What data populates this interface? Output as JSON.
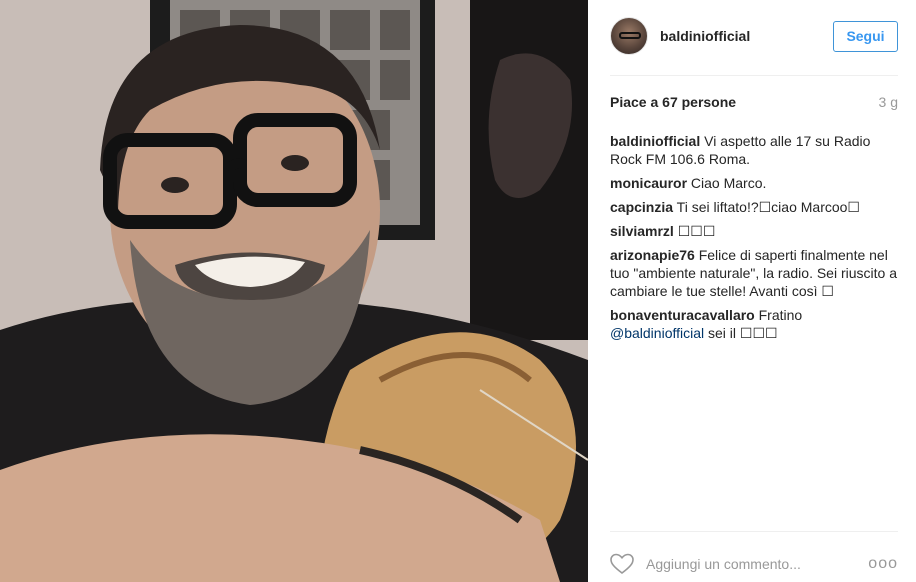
{
  "post": {
    "image_alt": "Selfie of a bearded man with black glasses holding a guitar",
    "username": "baldiniofficial",
    "follow_label": "Segui",
    "likes": "Piace a 67 persone",
    "age": "3 g",
    "comments": [
      {
        "user": "baldiniofficial",
        "text": "Vi aspetto alle 17 su Radio Rock FM 106.6 Roma."
      },
      {
        "user": "monicauror",
        "text": "Ciao Marco."
      },
      {
        "user": "capcinzia",
        "text": "Ti sei liftato!?☐ciao Marcoo☐"
      },
      {
        "user": "silviamrzl",
        "text": "☐☐☐"
      },
      {
        "user": "arizonapie76",
        "text": "Felice di saperti finalmente nel tuo \"ambiente naturale\", la radio. Sei riuscito a cambiare le tue stelle! Avanti così ☐"
      },
      {
        "user": "bonaventuracavallaro",
        "text": "Fratino",
        "mention": "@baldiniofficial",
        "text_after": " sei il ☐☐☐"
      }
    ],
    "comment_placeholder": "Aggiungi un commento...",
    "more_label": "ooo"
  },
  "icons": {
    "heart": "heart-outline-icon",
    "more": "more-options-icon"
  },
  "colors": {
    "link": "#3897f0",
    "text": "#262626",
    "muted": "#999999"
  }
}
